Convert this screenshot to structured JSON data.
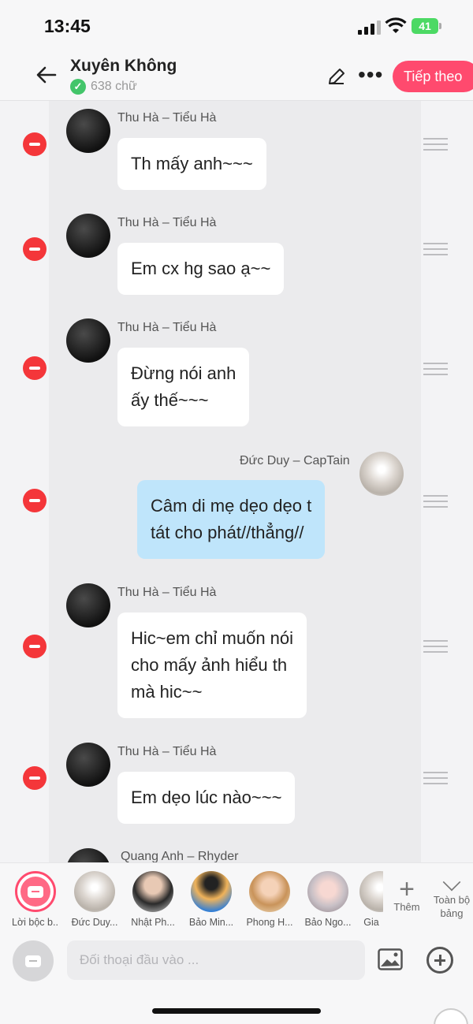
{
  "status": {
    "time": "13:45",
    "battery": "41"
  },
  "header": {
    "title": "Xuyên Không",
    "word_count": "638 chữ",
    "next_label": "Tiếp theo"
  },
  "messages": [
    {
      "sender": "Thu Hà – Tiểu Hà",
      "text": "Th mấy anh~~~",
      "side": "left"
    },
    {
      "sender": "Thu Hà – Tiểu Hà",
      "text": "Em cx hg sao ạ~~",
      "side": "left"
    },
    {
      "sender": "Thu Hà – Tiểu Hà",
      "text": "Đừng nói anh\nấy thế~~~",
      "side": "left"
    },
    {
      "sender": "Đức Duy – CapTain",
      "text": "Câm di mẹ dẹo dẹo t\ntát cho phát//thẳng//",
      "side": "right"
    },
    {
      "sender": "Thu Hà – Tiểu Hà",
      "text": "Hic~em chỉ muốn nói\ncho mấy ảnh hiểu th\nmà hic~~",
      "side": "left"
    },
    {
      "sender": "Thu Hà – Tiểu Hà",
      "text": "Em dẹo lúc nào~~~",
      "side": "left"
    },
    {
      "sender": "Quang Anh – Rhyder",
      "side": "left"
    }
  ],
  "cast": [
    {
      "name": "Lời bộc b..."
    },
    {
      "name": "Đức Duy..."
    },
    {
      "name": "Nhật Ph..."
    },
    {
      "name": "Bảo Min..."
    },
    {
      "name": "Phong H..."
    },
    {
      "name": "Bảo Ngo..."
    },
    {
      "name": "Gia"
    }
  ],
  "cast_more": "Thêm",
  "cast_all": "Toàn bộ bảng",
  "input": {
    "placeholder": "Đối thoại đầu vào ..."
  },
  "colors": {
    "accent": "#ff4a6e",
    "delete": "#f4363a",
    "my_bubble": "#bfe5fb",
    "verified": "#43c56a"
  }
}
